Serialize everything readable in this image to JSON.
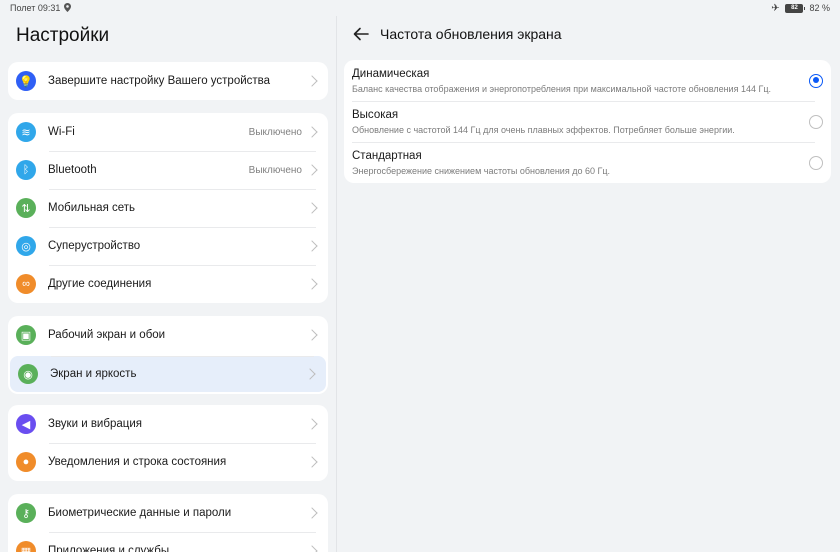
{
  "status": {
    "left_text": "Полет 09:31",
    "battery": "82",
    "battery_pct": "82 %"
  },
  "settings_title": "Настройки",
  "groups": [
    {
      "items": [
        {
          "name": "finish-setup",
          "icon": "lightbulb-icon",
          "color": "#2f5ff5",
          "glyph": "💡",
          "label": "Завершите настройку Вашего устройства",
          "value": ""
        }
      ]
    },
    {
      "items": [
        {
          "name": "wifi",
          "icon": "wifi-icon",
          "color": "#30a7ea",
          "glyph": "≋",
          "label": "Wi-Fi",
          "value": "Выключено"
        },
        {
          "name": "bluetooth",
          "icon": "bluetooth-icon",
          "color": "#30a7ea",
          "glyph": "ᛒ",
          "label": "Bluetooth",
          "value": "Выключено"
        },
        {
          "name": "mobile-network",
          "icon": "mobile-data-icon",
          "color": "#5ab05a",
          "glyph": "⇅",
          "label": "Мобильная сеть",
          "value": ""
        },
        {
          "name": "super-device",
          "icon": "super-device-icon",
          "color": "#30a7ea",
          "glyph": "◎",
          "label": "Суперустройство",
          "value": ""
        },
        {
          "name": "other-connections",
          "icon": "link-icon",
          "color": "#f08c2a",
          "glyph": "∞",
          "label": "Другие соединения",
          "value": ""
        }
      ]
    },
    {
      "items": [
        {
          "name": "home-wallpaper",
          "icon": "wallpaper-icon",
          "color": "#5ab05a",
          "glyph": "▣",
          "label": "Рабочий экран и обои",
          "value": ""
        },
        {
          "name": "display-brightness",
          "icon": "eye-icon",
          "color": "#5ab05a",
          "glyph": "◉",
          "label": "Экран и яркость",
          "value": "",
          "active": true
        }
      ]
    },
    {
      "items": [
        {
          "name": "sounds",
          "icon": "speaker-icon",
          "color": "#6a4ef0",
          "glyph": "◀",
          "label": "Звуки и вибрация",
          "value": ""
        },
        {
          "name": "notifications",
          "icon": "bell-icon",
          "color": "#f08c2a",
          "glyph": "●",
          "label": "Уведомления и строка состояния",
          "value": ""
        }
      ]
    },
    {
      "items": [
        {
          "name": "biometrics",
          "icon": "key-icon",
          "color": "#5ab05a",
          "glyph": "⚷",
          "label": "Биометрические данные и пароли",
          "value": ""
        },
        {
          "name": "apps",
          "icon": "apps-icon",
          "color": "#f08c2a",
          "glyph": "▦",
          "label": "Приложения и службы",
          "value": ""
        }
      ]
    }
  ],
  "detail": {
    "title": "Частота обновления экрана",
    "options": [
      {
        "title": "Динамическая",
        "desc": "Баланс качества отображения и энергопотребления при максимальной частоте обновления 144 Гц.",
        "selected": true
      },
      {
        "title": "Высокая",
        "desc": "Обновление с частотой 144 Гц для очень плавных эффектов. Потребляет больше энергии.",
        "selected": false
      },
      {
        "title": "Стандартная",
        "desc": "Энергосбережение снижением частоты обновления до 60 Гц.",
        "selected": false
      }
    ]
  },
  "colors": {
    "accent": "#0a59f7",
    "active_row": "#e6eefa"
  }
}
